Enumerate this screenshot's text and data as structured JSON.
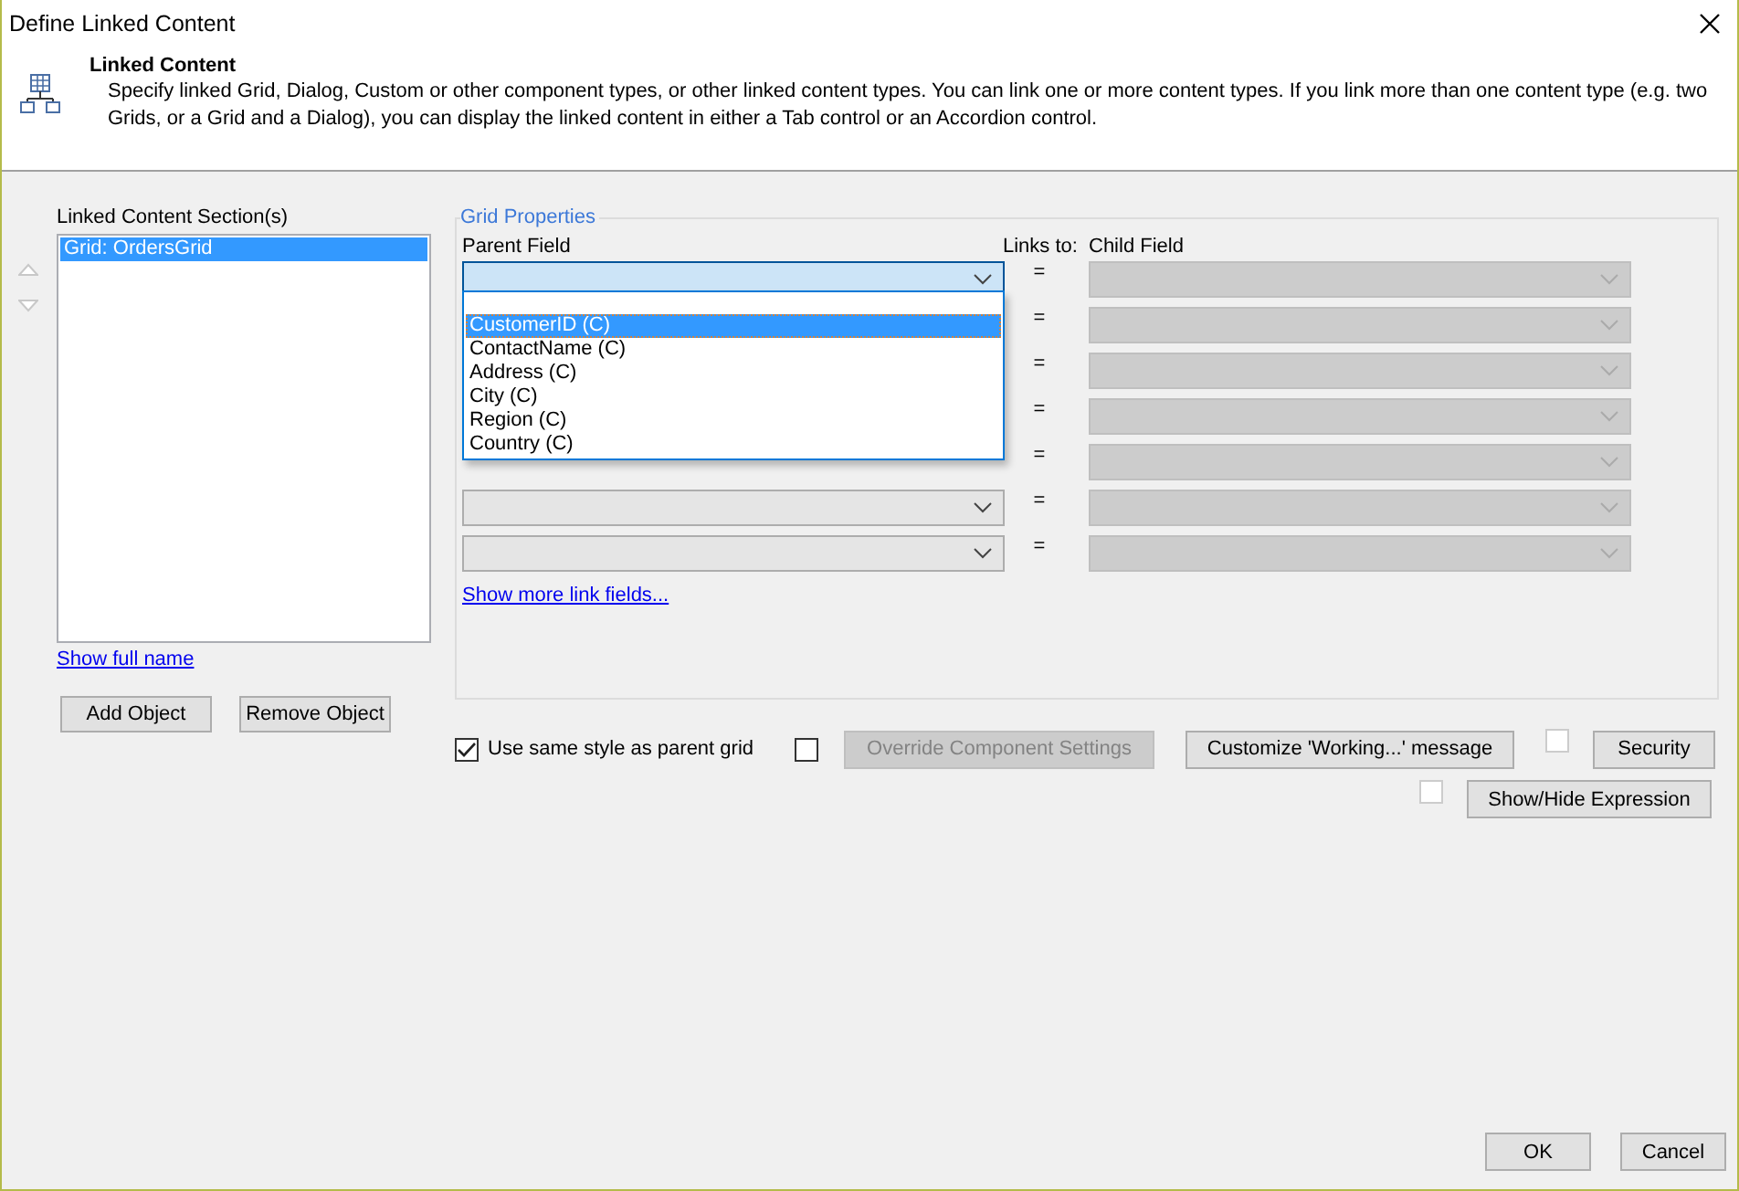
{
  "window": {
    "title": "Define Linked Content"
  },
  "header": {
    "title": "Linked Content",
    "description": "Specify linked Grid, Dialog, Custom or other component types, or other linked content types. You can link one or more content types. If you link more than one content type (e.g. two Grids, or a Grid and a Dialog), you can display the linked content in either a Tab control or an Accordion control."
  },
  "sections": {
    "label": "Linked Content Section(s)",
    "items": [
      {
        "text": "Grid: OrdersGrid",
        "selected": true
      }
    ],
    "show_full_name": "Show full name",
    "buttons": [
      "Add Object",
      "Remove Object"
    ]
  },
  "grid_properties": {
    "legend": "Grid Properties",
    "parent_label": "Parent Field",
    "links_label": "Links to:",
    "child_label": "Child Field",
    "rows": [
      {
        "equals": "=",
        "focused": true
      },
      {
        "equals": "="
      },
      {
        "equals": "="
      },
      {
        "equals": "="
      },
      {
        "equals": "="
      },
      {
        "equals": "=",
        "focused": false
      },
      {
        "equals": "=",
        "focused": false
      }
    ],
    "dropdown_options": [
      {
        "text": "CustomerID (C)",
        "selected": true
      },
      {
        "text": "ContactName (C)",
        "selected": false
      },
      {
        "text": "Address (C)",
        "selected": false
      },
      {
        "text": "City (C)",
        "selected": false
      },
      {
        "text": "Region (C)",
        "selected": false
      },
      {
        "text": "Country (C)",
        "selected": false
      }
    ],
    "show_more": "Show more link fields..."
  },
  "options": {
    "same_style": {
      "label": "Use same style as parent grid",
      "checked": true
    },
    "override": {
      "checked": false,
      "button": "Override Component Settings",
      "disabled": true
    },
    "customize": "Customize 'Working...' message",
    "security": {
      "checked": false,
      "disabled": true,
      "button": "Security"
    },
    "expression": {
      "checked": false,
      "disabled": true,
      "button": "Show/Hide Expression"
    }
  },
  "buttons": [
    "OK",
    "Cancel"
  ]
}
